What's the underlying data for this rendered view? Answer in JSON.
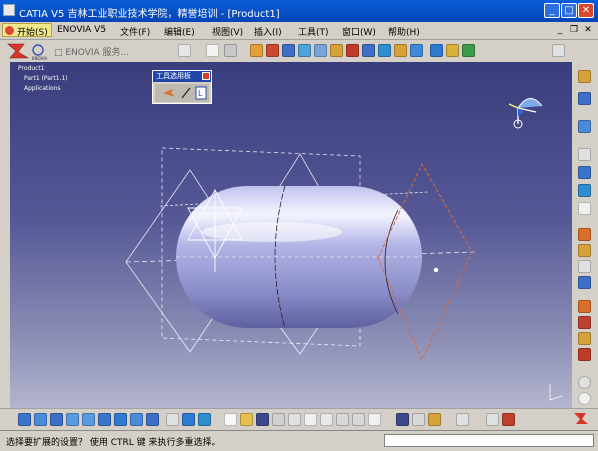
{
  "window": {
    "title": "CATIA V5 吉林工业职业技术学院，精誉培训 - [Product1]",
    "buttons": [
      "_",
      "□",
      "✕"
    ]
  },
  "menubar": {
    "start": "开始(S)",
    "items": [
      "ENOVIA V5",
      "文件(F)",
      "编辑(E)",
      "视图(V)",
      "插入(I)",
      "工具(T)",
      "窗口(W)",
      "帮助(H)"
    ]
  },
  "workbench": {
    "label": "ENOVIA",
    "hint": "□ ENOVIA 服务..."
  },
  "tree": {
    "root": "Product1",
    "child1": "Part1 (Part1.1)",
    "child2": "Applications"
  },
  "palette": {
    "title": "工具选用板"
  },
  "statusbar": {
    "message": "选择要扩展的设置？ 使用 CTRL 键 来执行多重选择。",
    "command_value": ""
  },
  "colors": {
    "titlebar": "#0a5fd8",
    "viewport_top": "#3a3d7c",
    "viewport_bottom": "#b3b5ce",
    "capsule": "#c9cbf2",
    "guides": "#ffffff",
    "selected_plane": "#d46a3a"
  },
  "icons": {
    "toolbar_top": [
      "filter-icon",
      "question-icon",
      "sketch-icon",
      "pad-icon",
      "pocket-icon",
      "shaft-icon",
      "groove-icon",
      "hole-icon",
      "rib-icon",
      "slot-icon",
      "stiffener-icon",
      "loft-icon",
      "remove-loft-icon",
      "fillet-icon",
      "chamfer-icon",
      "draft-icon",
      "shell-icon"
    ],
    "toolbar_bottom": [
      "fit-all-icon",
      "pan-icon",
      "rotate-icon",
      "zoom-in-icon",
      "zoom-out-icon",
      "normal-view-icon",
      "iso-view-icon",
      "shading-icon",
      "hide-show-icon",
      "swap-space-icon",
      "new-icon",
      "open-icon",
      "save-icon",
      "print-icon",
      "cut-icon",
      "copy-icon",
      "paste-icon",
      "undo-icon",
      "redo-icon",
      "what-this-icon",
      "measure-icon",
      "apply-material-icon",
      "rename-icon"
    ],
    "toolbar_right": [
      "plane-icon",
      "point-icon",
      "line-icon",
      "axis-icon",
      "sphere-icon",
      "box-icon",
      "mirror-icon",
      "pattern-icon",
      "scale-icon",
      "thickness-icon",
      "split-icon",
      "thread-icon",
      "constraint-icon",
      "analysis-icon",
      "catalog-icon",
      "update-icon",
      "knowledge-icon"
    ]
  }
}
